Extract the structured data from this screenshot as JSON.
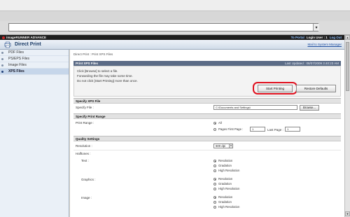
{
  "app": {
    "brand": "imageRUNNER ADVANCE",
    "title": "Direct Print",
    "header_links": {
      "to_portal": "To Portal",
      "login_user": "Login User : 1",
      "log_out": "Log Out"
    },
    "mail_link": "Mail to System Manager"
  },
  "browser": {
    "address_value": ""
  },
  "sidebar": {
    "items": [
      {
        "label": "PDF Files",
        "active": false
      },
      {
        "label": "PS/EPS Files",
        "active": false
      },
      {
        "label": "Image Files",
        "active": false
      },
      {
        "label": "XPS Files",
        "active": true
      }
    ]
  },
  "main": {
    "breadcrumb": "Direct Print : Print XPS Files",
    "panel": {
      "title": "Print XPS Files",
      "last_updated": "Last Updated : 08/07/2009 3:40:23 AM",
      "messages": [
        "Click [Browse] to select a file.",
        "Forwarding the file may take some time.",
        "Do not click [Start Printing] more than once."
      ],
      "start_printing": "Start Printing",
      "restore_defaults": "Restore Defaults"
    },
    "specify_file_section": {
      "header": "Specify XPS File",
      "label": "Specify File :",
      "value": "C:\\Documents and Settings\\",
      "browse": "Browse..."
    },
    "print_range_section": {
      "header": "Specify Print Range",
      "label": "Print Range :",
      "options": [
        "All",
        "Pages First Page :"
      ],
      "selected": "All",
      "first_page": "1",
      "last_page_label": "Last Page :",
      "last_page": "1"
    },
    "quality_section": {
      "header": "Quality Settings",
      "resolution_label": "Resolution :",
      "resolution_value": "600 dpi",
      "halftones_label": "Halftones :",
      "groups": [
        {
          "label": "Text :",
          "options": [
            "Resolution",
            "Gradation",
            "High Resolution"
          ],
          "selected": "Resolution"
        },
        {
          "label": "Graphics :",
          "options": [
            "Resolution",
            "Gradation",
            "High Resolution"
          ],
          "selected": "Resolution"
        },
        {
          "label": "Image :",
          "options": [
            "Resolution",
            "Gradation",
            "High Resolution"
          ],
          "selected": "Resolution"
        }
      ]
    }
  },
  "colors": {
    "highlight": "#e0101e",
    "panel_header": "#5b6b86",
    "title_text": "#1b3b66",
    "link": "#1f4fa0"
  },
  "icons": {
    "brand_logo": "canon-logo-icon",
    "title": "direct-print-icon",
    "address_dropdown": "chevron-down-icon",
    "scroll_up": "scroll-up-icon",
    "scroll_down": "scroll-down-icon"
  }
}
